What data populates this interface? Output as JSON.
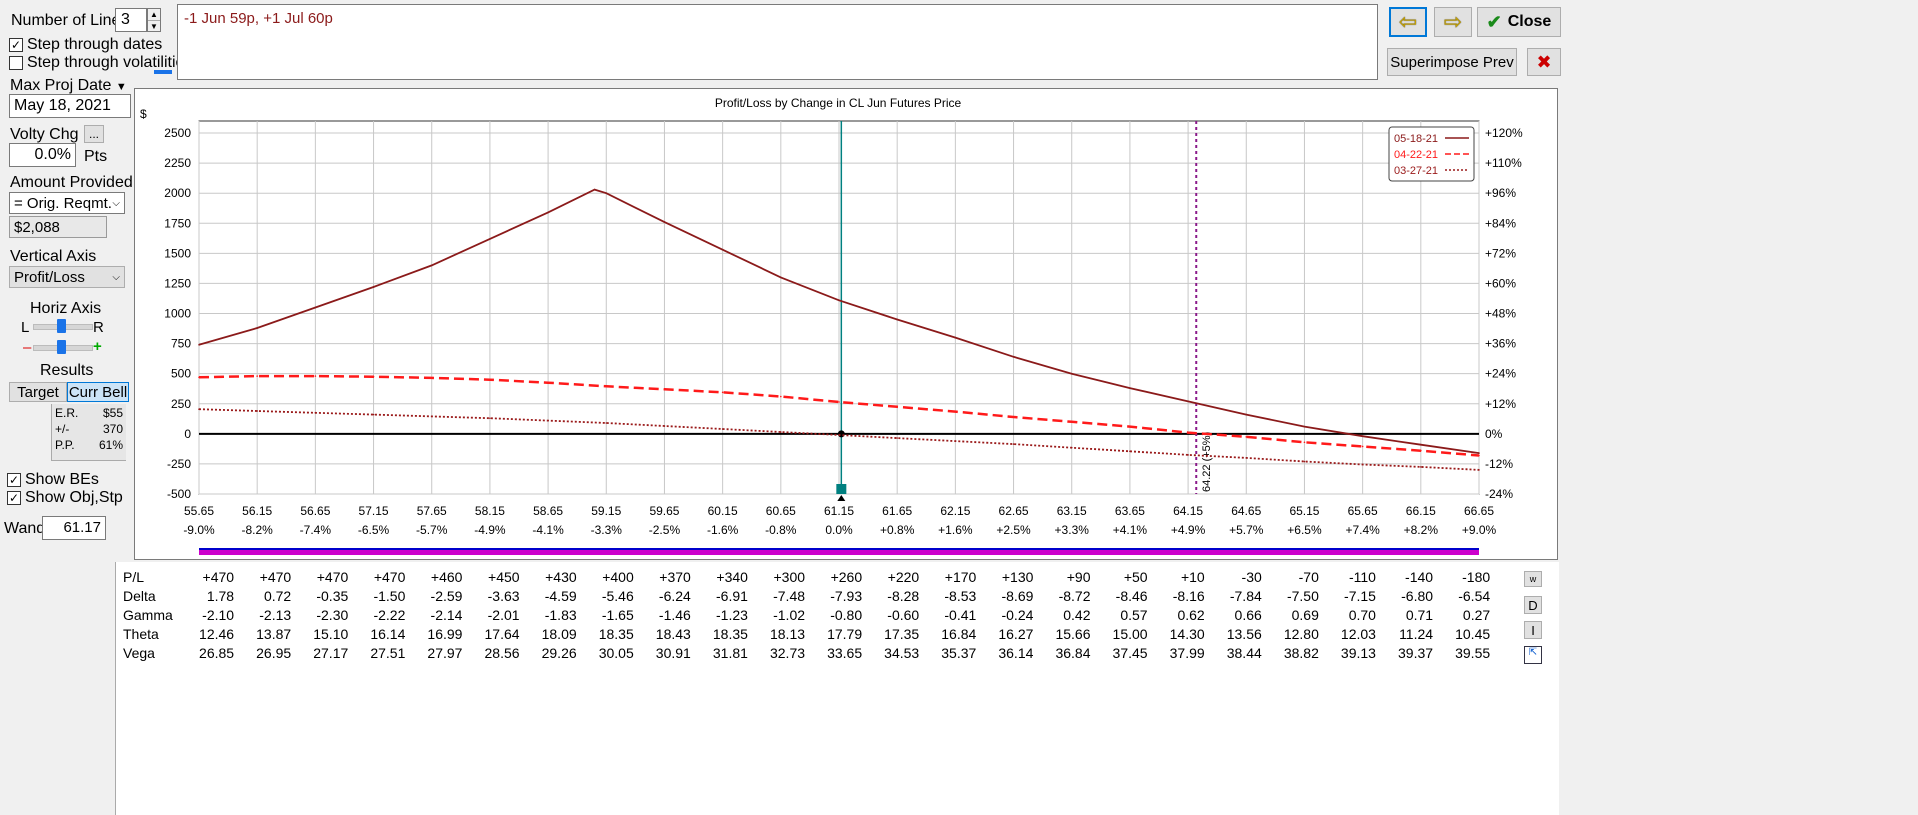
{
  "controls": {
    "num_lines_label": "Number of Lines",
    "num_lines_value": "3",
    "step_dates_label": "Step through dates",
    "step_dates_checked": true,
    "step_vols_label": "Step through volatilities",
    "step_vols_checked": false,
    "max_proj_date_label": "Max Proj Date",
    "max_proj_date_value": "May 18, 2021",
    "volty_chg_label": "Volty Chg",
    "volty_chg_button": "...",
    "volty_chg_value": "0.0%",
    "volty_chg_unit": "Pts",
    "amount_provided_label": "Amount Provided",
    "amount_provided_option": "= Orig. Reqmt.",
    "amount_value": "$2,088",
    "vertical_axis_label": "Vertical Axis",
    "vertical_axis_option": "Profit/Loss",
    "horiz_axis_label": "Horiz Axis",
    "horiz_l": "L",
    "horiz_r": "R",
    "zoom_minus": "–",
    "zoom_plus": "+",
    "results_label": "Results",
    "target_tab": "Target",
    "curr_bell_tab": "Curr Bell",
    "results": [
      {
        "k": "E.R.",
        "v": "$55"
      },
      {
        "k": "+/-",
        "v": "370"
      },
      {
        "k": "P.P.",
        "v": "61%"
      }
    ],
    "show_bes_label": "Show BEs",
    "show_bes_checked": true,
    "show_obj_label": "Show Obj,Stp",
    "show_obj_checked": true,
    "wand_label": "Wand",
    "wand_value": "61.17"
  },
  "position_text": "-1 Jun 59p, +1 Jul 60p",
  "buttons": {
    "close": "Close",
    "superimpose": "Superimpose Prev",
    "back_arrow": "⇦",
    "fwd_arrow": "⇨",
    "checkmark": "✔",
    "delete_x": "✖"
  },
  "chart_data": {
    "type": "line",
    "title": "Profit/Loss by Change in CL Jun Futures Price",
    "ylabel": "$",
    "x": [
      55.65,
      56.15,
      56.65,
      57.15,
      57.65,
      58.15,
      58.65,
      59.15,
      59.65,
      60.15,
      60.65,
      61.15,
      61.65,
      62.15,
      62.65,
      63.15,
      63.65,
      64.15,
      64.65,
      65.15,
      65.65,
      66.15,
      66.65
    ],
    "x_pct_labels": [
      "-9.0%",
      "-8.2%",
      "-7.4%",
      "-6.5%",
      "-5.7%",
      "-4.9%",
      "-4.1%",
      "-3.3%",
      "-2.5%",
      "-1.6%",
      "-0.8%",
      "0.0%",
      "+0.8%",
      "+1.6%",
      "+2.5%",
      "+3.3%",
      "+4.1%",
      "+4.9%",
      "+5.7%",
      "+6.5%",
      "+7.4%",
      "+8.2%",
      "+9.0%"
    ],
    "xlim": [
      55.65,
      66.65
    ],
    "ylim": [
      -500,
      2600
    ],
    "y_ticks": [
      2500,
      2250,
      2000,
      1750,
      1500,
      1250,
      1000,
      750,
      500,
      250,
      0,
      -250,
      -500
    ],
    "right_ticks": [
      "+120%",
      "+110%",
      "+96%",
      "+84%",
      "+72%",
      "+60%",
      "+48%",
      "+36%",
      "+24%",
      "+12%",
      "0%",
      "-12%",
      "-24%"
    ],
    "series": [
      {
        "name": "05-18-21",
        "color": "#8b1a1a",
        "style": "solid",
        "x": [
          55.65,
          56.15,
          56.65,
          57.15,
          57.65,
          58.15,
          58.65,
          59.05,
          59.15,
          59.65,
          60.15,
          60.65,
          61.15,
          61.65,
          62.15,
          62.65,
          63.15,
          63.65,
          64.15,
          64.65,
          65.15,
          65.65,
          66.15,
          66.65
        ],
        "y": [
          740,
          880,
          1050,
          1220,
          1400,
          1620,
          1840,
          2030,
          2000,
          1760,
          1530,
          1300,
          1110,
          950,
          800,
          640,
          500,
          380,
          270,
          160,
          60,
          -20,
          -90,
          -160
        ]
      },
      {
        "name": "04-22-21",
        "color": "#ff1a1a",
        "style": "dash",
        "x": [
          55.65,
          56.15,
          56.65,
          57.15,
          57.65,
          58.15,
          58.65,
          59.15,
          59.65,
          60.15,
          60.65,
          61.15,
          61.65,
          62.15,
          62.65,
          63.15,
          63.65,
          64.15,
          64.65,
          65.15,
          65.65,
          66.15,
          66.65
        ],
        "y": [
          470,
          480,
          480,
          475,
          465,
          450,
          425,
          395,
          370,
          345,
          310,
          265,
          225,
          185,
          140,
          100,
          60,
          10,
          -25,
          -70,
          -105,
          -140,
          -180
        ]
      },
      {
        "name": "03-27-21",
        "color": "#9a1a1a",
        "style": "dot",
        "x": [
          55.65,
          56.15,
          56.65,
          57.15,
          57.65,
          58.15,
          58.65,
          59.15,
          59.65,
          60.15,
          60.65,
          61.15,
          61.65,
          62.15,
          62.65,
          63.15,
          63.65,
          64.15,
          64.65,
          65.15,
          65.65,
          66.15,
          66.65
        ],
        "y": [
          205,
          190,
          175,
          160,
          145,
          130,
          110,
          90,
          65,
          40,
          15,
          -10,
          -35,
          -60,
          -85,
          -115,
          -145,
          -175,
          -200,
          -230,
          -255,
          -275,
          -300
        ]
      }
    ],
    "current_price": 61.17,
    "target_line": 64.22,
    "target_label": "64.22 (+5%)"
  },
  "greeks": {
    "rows": [
      {
        "name": "P/L",
        "values": [
          "+470",
          "+470",
          "+470",
          "+470",
          "+460",
          "+450",
          "+430",
          "+400",
          "+370",
          "+340",
          "+300",
          "+260",
          "+220",
          "+170",
          "+130",
          "+90",
          "+50",
          "+10",
          "-30",
          "-70",
          "-110",
          "-140",
          "-180"
        ]
      },
      {
        "name": "Delta",
        "values": [
          "1.78",
          "0.72",
          "-0.35",
          "-1.50",
          "-2.59",
          "-3.63",
          "-4.59",
          "-5.46",
          "-6.24",
          "-6.91",
          "-7.48",
          "-7.93",
          "-8.28",
          "-8.53",
          "-8.69",
          "-8.72",
          "-8.46",
          "-8.16",
          "-7.84",
          "-7.50",
          "-7.15",
          "-6.80",
          "-6.54"
        ]
      },
      {
        "name": "Gamma",
        "values": [
          "-2.10",
          "-2.13",
          "-2.30",
          "-2.22",
          "-2.14",
          "-2.01",
          "-1.83",
          "-1.65",
          "-1.46",
          "-1.23",
          "-1.02",
          "-0.80",
          "-0.60",
          "-0.41",
          "-0.24",
          "0.42",
          "0.57",
          "0.62",
          "0.66",
          "0.69",
          "0.70",
          "0.71",
          "0.27"
        ]
      },
      {
        "name": "Theta",
        "values": [
          "12.46",
          "13.87",
          "15.10",
          "16.14",
          "16.99",
          "17.64",
          "18.09",
          "18.35",
          "18.43",
          "18.35",
          "18.13",
          "17.79",
          "17.35",
          "16.84",
          "16.27",
          "15.66",
          "15.00",
          "14.30",
          "13.56",
          "12.80",
          "12.03",
          "11.24",
          "10.45"
        ]
      },
      {
        "name": "Vega",
        "values": [
          "26.85",
          "26.95",
          "27.17",
          "27.51",
          "27.97",
          "28.56",
          "29.26",
          "30.05",
          "30.91",
          "31.81",
          "32.73",
          "33.65",
          "34.53",
          "35.37",
          "36.14",
          "36.84",
          "37.45",
          "37.99",
          "38.44",
          "38.82",
          "39.13",
          "39.37",
          "39.55"
        ]
      }
    ],
    "side_buttons": [
      "w",
      "D",
      "I"
    ]
  }
}
